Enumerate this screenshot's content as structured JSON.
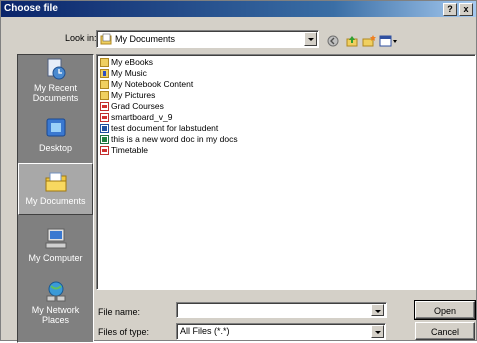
{
  "window": {
    "title": "Choose file",
    "help_label": "?",
    "close_label": "x"
  },
  "lookin": {
    "label": "Look in:",
    "value": "My Documents"
  },
  "toolbar": {
    "icons": [
      "back-icon",
      "up-folder-icon",
      "new-folder-icon",
      "views-menu-icon"
    ]
  },
  "places": [
    {
      "label": "My Recent Documents",
      "icon": "recent-documents-icon"
    },
    {
      "label": "Desktop",
      "icon": "desktop-icon"
    },
    {
      "label": "My Documents",
      "icon": "my-documents-icon",
      "selected": true
    },
    {
      "label": "My Computer",
      "icon": "my-computer-icon"
    },
    {
      "label": "My Network Places",
      "icon": "network-places-icon"
    }
  ],
  "files": [
    {
      "name": "My eBooks",
      "type": "folder"
    },
    {
      "name": "My Music",
      "type": "music"
    },
    {
      "name": "My Notebook Content",
      "type": "folder"
    },
    {
      "name": "My Pictures",
      "type": "folder"
    },
    {
      "name": "Grad Courses",
      "type": "pdf"
    },
    {
      "name": "smartboard_v_9",
      "type": "pdf"
    },
    {
      "name": "test document for labstudent",
      "type": "doc"
    },
    {
      "name": "this is a new word doc in my docs",
      "type": "xls"
    },
    {
      "name": "Timetable",
      "type": "pdf"
    }
  ],
  "filename": {
    "label": "File name:",
    "value": ""
  },
  "filetype": {
    "label": "Files of type:",
    "value": "All Files (*.*)"
  },
  "buttons": {
    "open": "Open",
    "cancel": "Cancel"
  }
}
